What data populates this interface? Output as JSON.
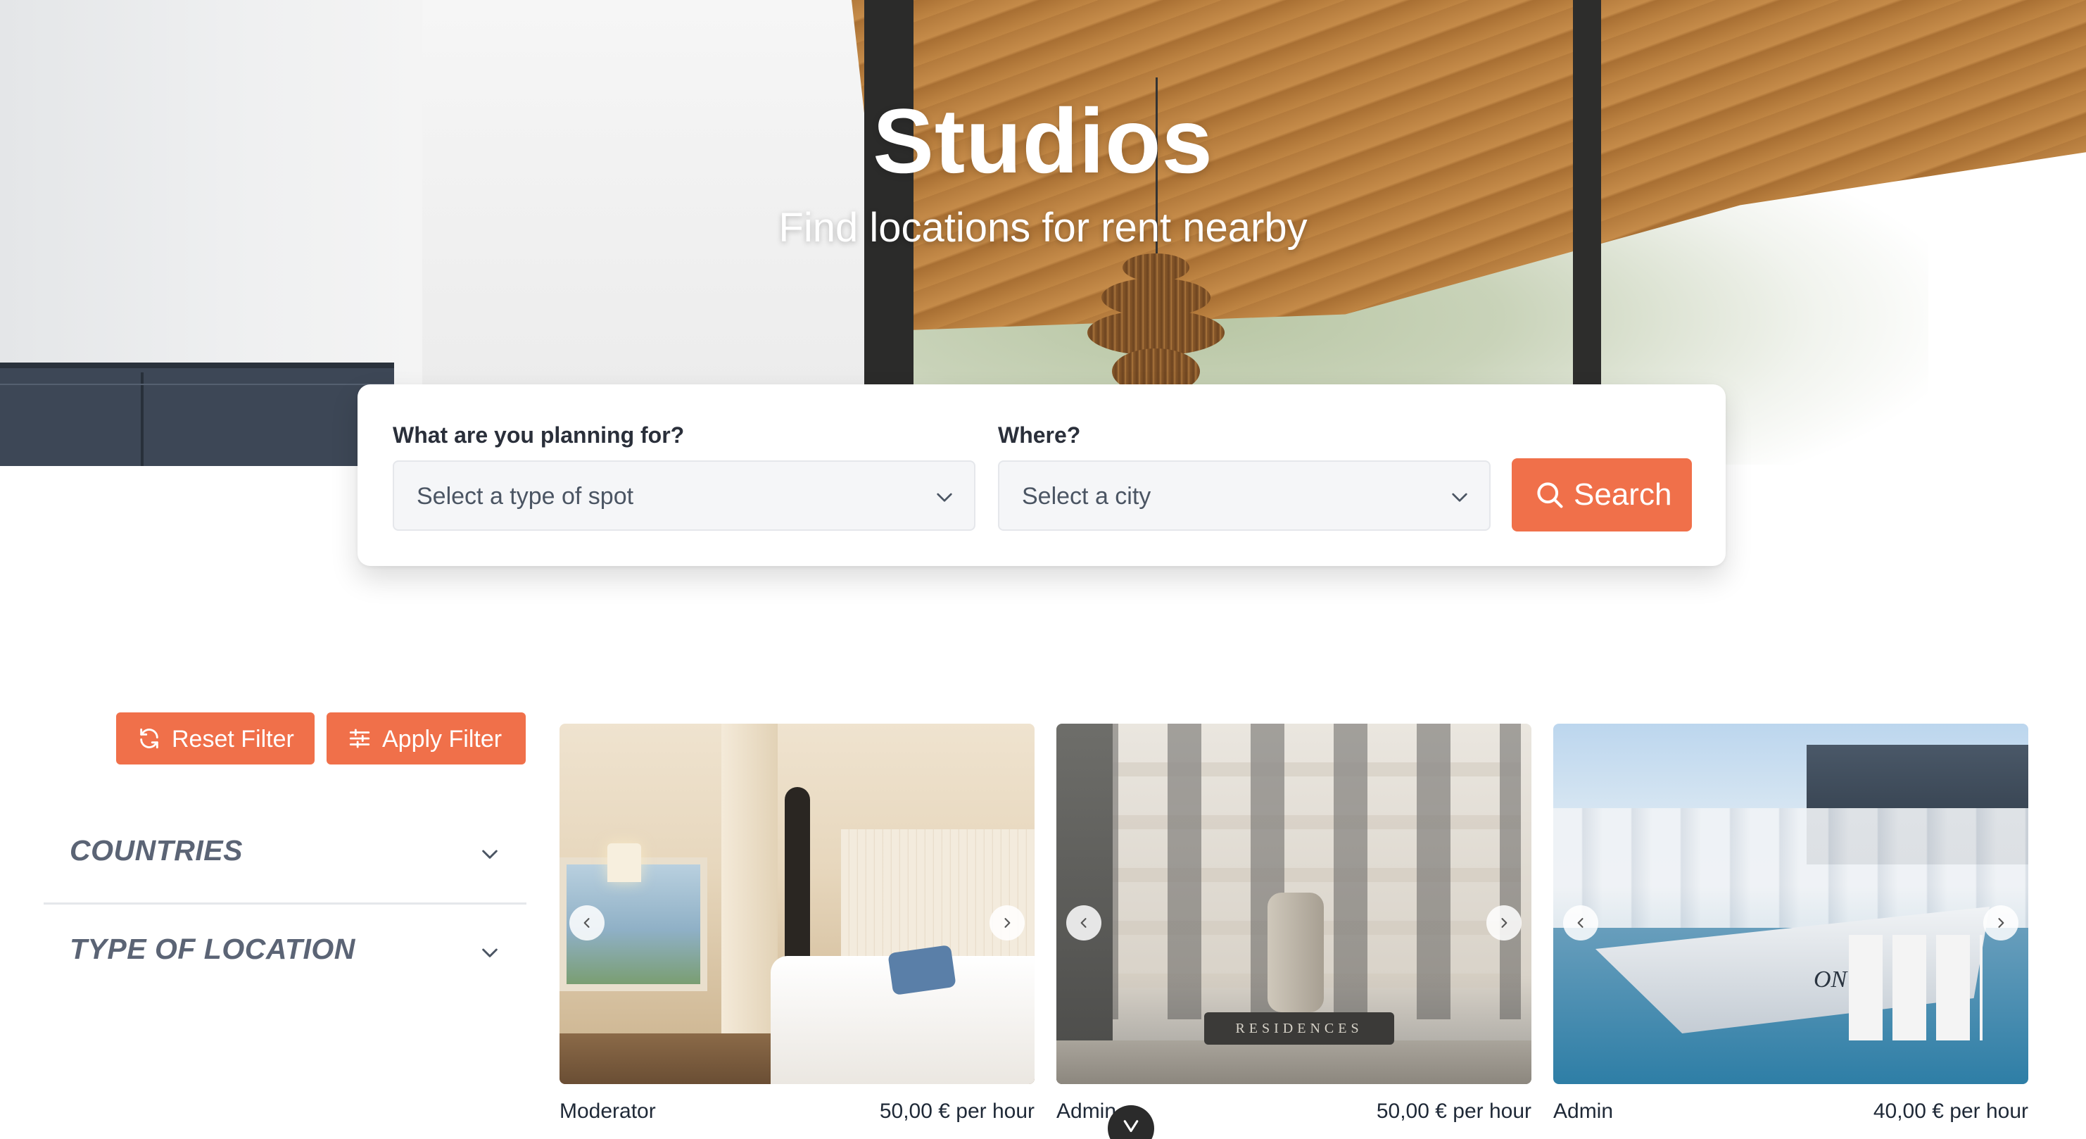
{
  "hero": {
    "title": "Studios",
    "subtitle": "Find locations for rent nearby"
  },
  "search": {
    "type_label": "What are you planning for?",
    "type_placeholder": "Select a type of spot",
    "city_label": "Where?",
    "city_placeholder": "Select a city",
    "button_label": "Search"
  },
  "filters": {
    "reset_label": "Reset Filter",
    "apply_label": "Apply Filter",
    "sections": [
      {
        "title": "COUNTRIES"
      },
      {
        "title": "TYPE OF LOCATION"
      }
    ]
  },
  "listings": [
    {
      "owner": "Moderator",
      "price": "50,00 € per hour",
      "image": "hotel-room"
    },
    {
      "owner": "Admin",
      "price": "50,00 € per hour",
      "image": "residences-building"
    },
    {
      "owner": "Admin",
      "price": "40,00 € per hour",
      "image": "boat-marina"
    }
  ],
  "colors": {
    "accent": "#f0704a",
    "filter_heading": "#5b6475",
    "text": "#1f2937"
  },
  "icons": {
    "search": "search-icon",
    "reset": "refresh-icon",
    "apply": "sliders-icon",
    "chevron": "chevron-down-icon",
    "carousel_prev": "chevron-left-icon",
    "carousel_next": "chevron-right-icon"
  }
}
